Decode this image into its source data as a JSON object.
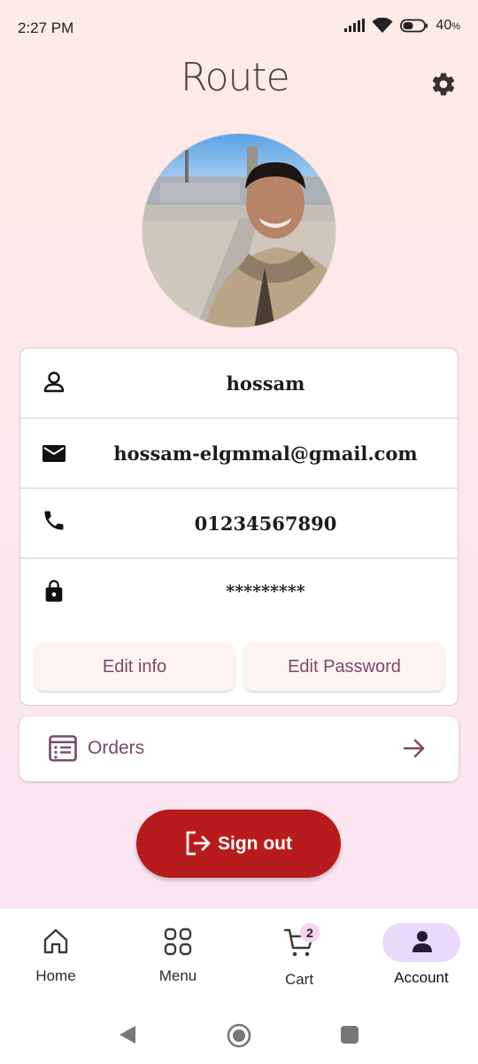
{
  "status": {
    "time": "2:27 PM",
    "battery_percent": "40",
    "battery_unit": "%",
    "icons": [
      "signal-icon",
      "wifi-icon",
      "battery-icon"
    ]
  },
  "header": {
    "logo_text": "Route",
    "settings_icon": "gear-icon"
  },
  "profile": {
    "name": "hossam",
    "email": "hossam-elgmmal@gmail.com",
    "phone": "01234567890",
    "password_masked": "*********",
    "edit_info_label": "Edit info",
    "edit_password_label": "Edit Password"
  },
  "orders": {
    "label": "Orders"
  },
  "signout": {
    "label": "Sign out"
  },
  "bottom_nav": {
    "items": [
      {
        "label": "Home",
        "icon": "home-icon"
      },
      {
        "label": "Menu",
        "icon": "grid-icon"
      },
      {
        "label": "Cart",
        "icon": "cart-icon",
        "badge": "2"
      },
      {
        "label": "Account",
        "icon": "person-icon",
        "active": true
      }
    ]
  },
  "colors": {
    "accent": "#7c4866",
    "signout_red": "#b81b1b",
    "active_pill": "#ead9fb",
    "badge": "#f7d4ee"
  }
}
